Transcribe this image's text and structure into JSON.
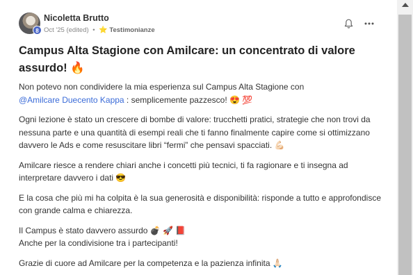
{
  "post": {
    "author": "Nicoletta Brutto",
    "avatar_badge": "8",
    "date": "Oct '25 (edited)",
    "separator": "•",
    "category_icon": "star-icon",
    "category": "Testimonianze",
    "title": "Campus Alta Stagione con Amilcare: un concentrato di valore assurdo! 🔥",
    "p1_line1": "Non potevo non condividere la mia esperienza sul Campus Alta Stagione con",
    "p1_mention": "@Amilcare Duecento Kappa",
    "p1_rest": " : semplicemente pazzesco! 😍 💯",
    "p2": "Ogni lezione è stato un crescere di bombe di valore: trucchetti pratici, strategie che non trovi da nessuna parte e una quantità di esempi reali che ti fanno finalmente capire come si ottimizzano davvero le Ads e come resuscitare libri “fermi” che pensavi spacciati. 💪🏻",
    "p3": "Amilcare riesce a rendere chiari anche i concetti più tecnici, ti fa ragionare e ti insegna ad interpretare davvero i dati 😎",
    "p4": "E la cosa che più mi ha colpita è la sua generosità e disponibilità: risponde a tutto e approfondisce con grande calma e chiarezza.",
    "p5_line1": "Il Campus è stato davvero assurdo 💣 🚀 📕",
    "p5_line2": "Anche per la condivisione tra i partecipanti!",
    "p6": "Grazie di cuore ad Amilcare per la competenza e la pazienza infinita 🙏🏻"
  },
  "icons": {
    "notification": "bell-icon",
    "more": "more-options-icon",
    "scroll_up": "scroll-up-arrow-icon"
  },
  "colors": {
    "mention": "#3a6bd8",
    "badge": "#4b67c6",
    "star": "#e9a800"
  }
}
